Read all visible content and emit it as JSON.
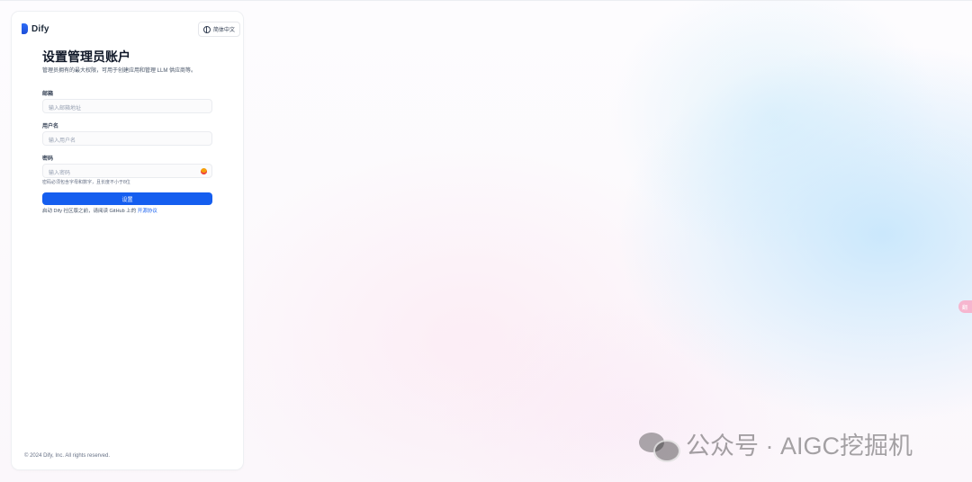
{
  "app": {
    "logo_text": "Dify",
    "language_label": "简体中文"
  },
  "form": {
    "title": "设置管理员账户",
    "subtitle": "管理员拥有的最大权限，可用于创建应用和管理 LLM 供应商等。",
    "email": {
      "label": "邮箱",
      "placeholder": "输入邮箱地址",
      "value": ""
    },
    "username": {
      "label": "用户名",
      "placeholder": "输入用户名",
      "value": ""
    },
    "password": {
      "label": "密码",
      "placeholder": "输入密码",
      "value": "",
      "hint": "密码必须包含字母和数字，且长度不小于8位"
    },
    "submit_label": "设置",
    "license_text": "启动 Dify 社区版之前，请阅读 GitHub 上的",
    "license_link": "开源协议"
  },
  "footer": {
    "copyright": "© 2024 Dify, Inc. All rights reserved."
  },
  "side_tab": {
    "label": "翻"
  },
  "watermark": {
    "text": "公众号 · AIGC挖掘机"
  },
  "colors": {
    "primary": "#155EEF",
    "text": "#101828",
    "muted": "#667085",
    "border": "#EAECF0"
  },
  "icons": [
    "dify-logo-icon",
    "globe-icon",
    "eye-icon",
    "wechat-icon"
  ]
}
